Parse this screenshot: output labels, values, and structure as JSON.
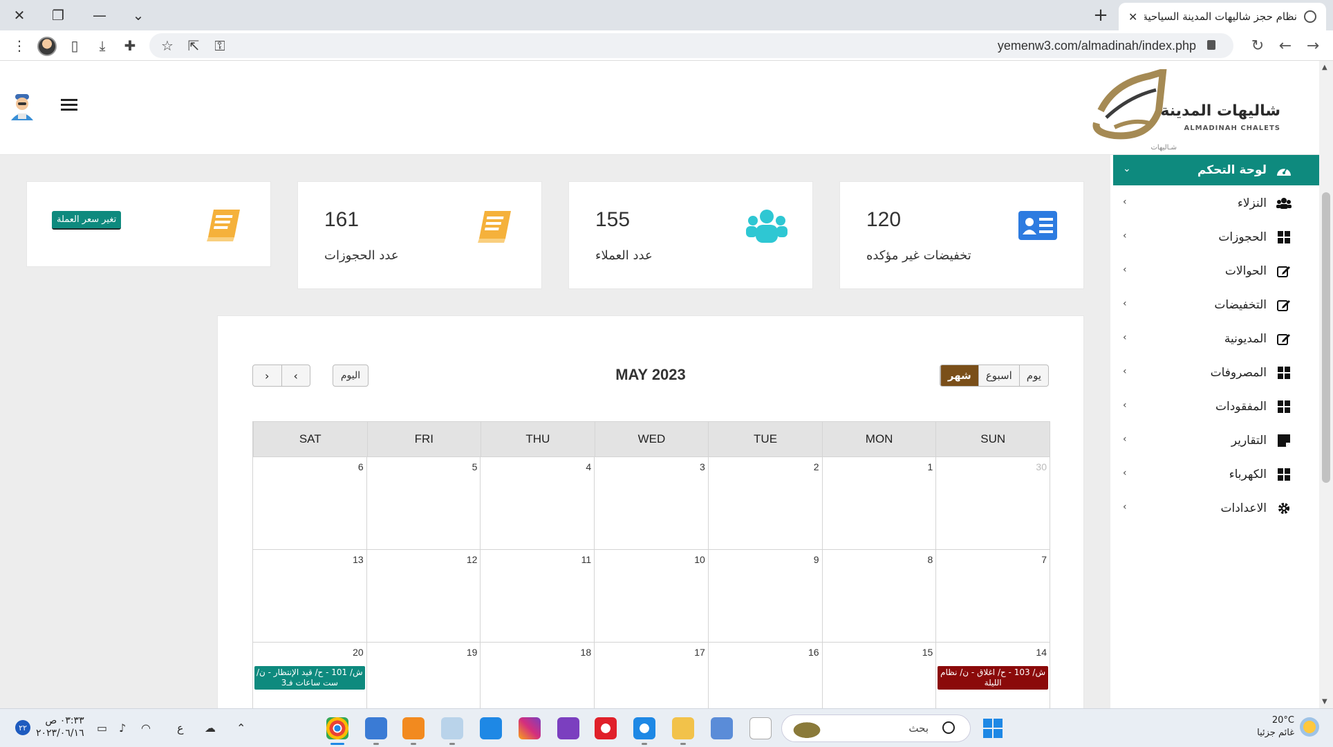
{
  "browser": {
    "tab_title": "نظام حجز شاليهات المدينة السياحية",
    "url": "yemenw3.com/almadinah/index.php"
  },
  "header": {
    "logo_arabic": "شاليهات المدينة",
    "logo_english": "ALMADINAH CHALETS",
    "logo_sub": "شـاليهات"
  },
  "sidebar": {
    "items": [
      {
        "label": "لوحة التحكم",
        "icon": "dashboard-icon",
        "active": true
      },
      {
        "label": "النزلاء",
        "icon": "users-icon"
      },
      {
        "label": "الحجوزات",
        "icon": "grid-icon"
      },
      {
        "label": "الحوالات",
        "icon": "edit-icon"
      },
      {
        "label": "التخفيضات",
        "icon": "edit-icon"
      },
      {
        "label": "المديونية",
        "icon": "edit-icon"
      },
      {
        "label": "المصروفات",
        "icon": "grid-icon"
      },
      {
        "label": "المفقودات",
        "icon": "grid-icon"
      },
      {
        "label": "التقارير",
        "icon": "sticky-note-icon"
      },
      {
        "label": "الكهرباء",
        "icon": "grid-icon"
      },
      {
        "label": "الاعدادات",
        "icon": "gear-icon"
      }
    ]
  },
  "stats": {
    "discounts": {
      "value": "120",
      "label": "تخفيضات غير مؤكده"
    },
    "customers": {
      "value": "155",
      "label": "عدد العملاء"
    },
    "bookings": {
      "value": "161",
      "label": "عدد الحجوزات"
    },
    "currency_button": "تغير سعر العملة"
  },
  "calendar": {
    "title": "MAY 2023",
    "today": "اليوم",
    "views": {
      "month": "شهر",
      "week": "اسبوع",
      "day": "يوم"
    },
    "days": [
      "SUN",
      "MON",
      "TUE",
      "WED",
      "THU",
      "FRI",
      "SAT"
    ],
    "weeks": [
      [
        {
          "d": "30",
          "other": true
        },
        {
          "d": "1"
        },
        {
          "d": "2"
        },
        {
          "d": "3"
        },
        {
          "d": "4"
        },
        {
          "d": "5"
        },
        {
          "d": "6"
        }
      ],
      [
        {
          "d": "7"
        },
        {
          "d": "8"
        },
        {
          "d": "9"
        },
        {
          "d": "10"
        },
        {
          "d": "11"
        },
        {
          "d": "12"
        },
        {
          "d": "13"
        }
      ],
      [
        {
          "d": "14",
          "event": "ش/ 103 - ح/ اغلاق - ن/ نظام الليلة",
          "color": "#8b0a0a"
        },
        {
          "d": "15"
        },
        {
          "d": "16"
        },
        {
          "d": "17"
        },
        {
          "d": "18"
        },
        {
          "d": "19"
        },
        {
          "d": "20",
          "event": "ش/ 101 - ح/ قيد الإنتظار - ن/ ست ساعات فـ3",
          "color": "#0e8a7e"
        }
      ]
    ]
  },
  "taskbar": {
    "temperature": "20°C",
    "weather": "غائم جزئيا",
    "search_placeholder": "بحث",
    "time": "٠٣:٣٣ ص",
    "date": "٢٠٢٣/٠٦/١٦",
    "lang": "ع",
    "badge": "٢٢"
  },
  "colors": {
    "accent": "#0e8a7e",
    "brown": "#7a4f19",
    "event_red": "#8b0a0a",
    "icon_orange": "#f5b13b",
    "icon_cyan": "#2ec7d3",
    "icon_blue": "#2d7be0"
  }
}
